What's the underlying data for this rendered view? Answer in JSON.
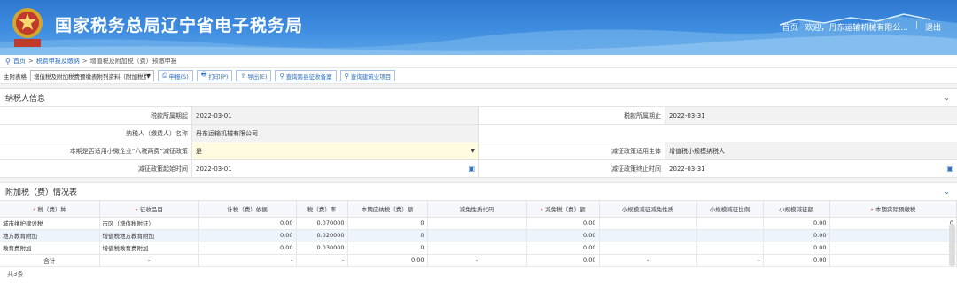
{
  "header": {
    "title": "国家税务总局辽宁省电子税务局",
    "emblem_text": "中国税务",
    "links": [
      "首页",
      "欢迎，丹东运输机械有限公...",
      "退出"
    ]
  },
  "breadcrumb": [
    "首页",
    "税费申报及缴纳",
    "增值税及附加税（费）预缴申报"
  ],
  "toolbar": {
    "label": "主附表格",
    "select_value": "增值税及附加税费预缴表附列资料（附加税费情况表）",
    "buttons": [
      "申报(S)",
      "打印(P)",
      "导出(E)",
      "查询跨县征收备案",
      "查询建筑业项目"
    ]
  },
  "taxpayer": {
    "section_title": "纳税人信息",
    "period_start_label": "税款所属期起",
    "period_start": "2022-03-01",
    "period_end_label": "税款所属期止",
    "period_end": "2022-03-31",
    "name_label": "纳税人（缴费人）名称",
    "name": "丹东运输机械有限公司",
    "policy_label": "本期是否适用小微企业“六税两费”减征政策",
    "policy_value": "是",
    "subject_label": "减征政策适用主体",
    "subject_value": "增值税小规模纳税人",
    "policy_start_label": "减征政策起始时间",
    "policy_start": "2022-03-01",
    "policy_end_label": "减征政策终止时间",
    "policy_end": "2022-03-31"
  },
  "surcharge": {
    "section_title": "附加税（费）情况表",
    "columns": [
      "税（费）种",
      "征收品目",
      "计税（费）依据",
      "税（费）率",
      "本期应纳税（费）额",
      "减免性质代码",
      "减免税（费）额",
      "小规模减征减免性质",
      "小规模减征比例",
      "小规模减征额",
      "本期实际预缴税"
    ],
    "rows": [
      [
        "城市维护建设税",
        "市区（增值税附征）",
        "0.00",
        "0.070000",
        "0",
        "",
        "0.00",
        "",
        "",
        "0.00",
        "0"
      ],
      [
        "地方教育附加",
        "增值税地方教育附加",
        "0.00",
        "0.020000",
        "0",
        "",
        "0.00",
        "",
        "",
        "0.00",
        "0"
      ],
      [
        "教育费附加",
        "增值税教育费附加",
        "0.00",
        "0.030000",
        "0",
        "",
        "0.00",
        "",
        "",
        "0.00",
        "0"
      ]
    ],
    "total": [
      "合计",
      "-",
      "-",
      "-",
      "0.00",
      "-",
      "0.00",
      "-",
      "-",
      "0.00",
      "0"
    ],
    "count": "共3条"
  }
}
